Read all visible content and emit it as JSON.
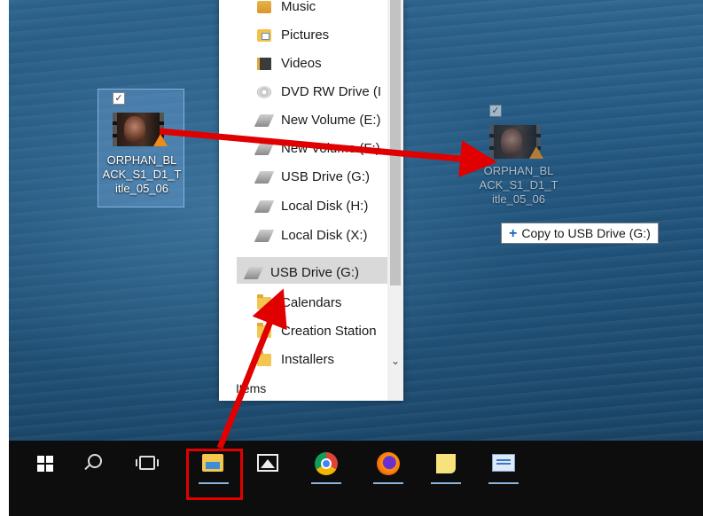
{
  "desktop_icon": {
    "label": "ORPHAN_BLACK_S1_D1_Title_05_06",
    "label_lines": [
      "ORPHAN_BL",
      "ACK_S1_D1_T",
      "itle_05_06"
    ],
    "checkbox": "✓"
  },
  "drag_ghost": {
    "label_lines": [
      "ORPHAN_BL",
      "ACK_S1_D1_T",
      "itle_05_06"
    ],
    "checkbox": "✓"
  },
  "tooltip": {
    "plus": "+",
    "text": "Copy to USB Drive (G:)"
  },
  "explorer": {
    "nav_items": [
      {
        "label": "Music",
        "icon": "music-folder-icon"
      },
      {
        "label": "Pictures",
        "icon": "pictures-folder-icon"
      },
      {
        "label": "Videos",
        "icon": "videos-folder-icon"
      },
      {
        "label": "DVD RW Drive (I",
        "icon": "dvd-drive-icon"
      },
      {
        "label": "New Volume (E:)",
        "icon": "drive-icon"
      },
      {
        "label": "New Volume (F:)",
        "icon": "drive-icon"
      },
      {
        "label": "USB Drive (G:)",
        "icon": "drive-icon"
      },
      {
        "label": "Local Disk (H:)",
        "icon": "drive-icon"
      },
      {
        "label": "Local Disk (X:)",
        "icon": "drive-icon"
      }
    ],
    "selected": {
      "label": "USB Drive (G:)",
      "icon": "usb-drive-icon"
    },
    "sub_items": [
      {
        "label": "Calendars",
        "icon": "folder-icon"
      },
      {
        "label": "Creation Station",
        "icon": "folder-icon"
      },
      {
        "label": "Installers",
        "icon": "folder-icon"
      },
      {
        "label": "Items",
        "icon": "folder-icon"
      }
    ]
  },
  "taskbar": {
    "items": [
      {
        "name": "start-button",
        "icon": "windows-logo-icon"
      },
      {
        "name": "search-button",
        "icon": "search-icon"
      },
      {
        "name": "task-view-button",
        "icon": "task-view-icon"
      },
      {
        "name": "file-explorer-button",
        "icon": "file-explorer-icon"
      },
      {
        "name": "photos-button",
        "icon": "photos-icon"
      },
      {
        "name": "chrome-button",
        "icon": "chrome-icon"
      },
      {
        "name": "firefox-button",
        "icon": "firefox-icon"
      },
      {
        "name": "sticky-notes-button",
        "icon": "sticky-notes-icon"
      },
      {
        "name": "app-button",
        "icon": "contact-card-icon"
      }
    ]
  },
  "colors": {
    "annotation_arrow": "#e00000",
    "tooltip_plus": "#1466c6",
    "taskbar": "#0d0d0d"
  }
}
